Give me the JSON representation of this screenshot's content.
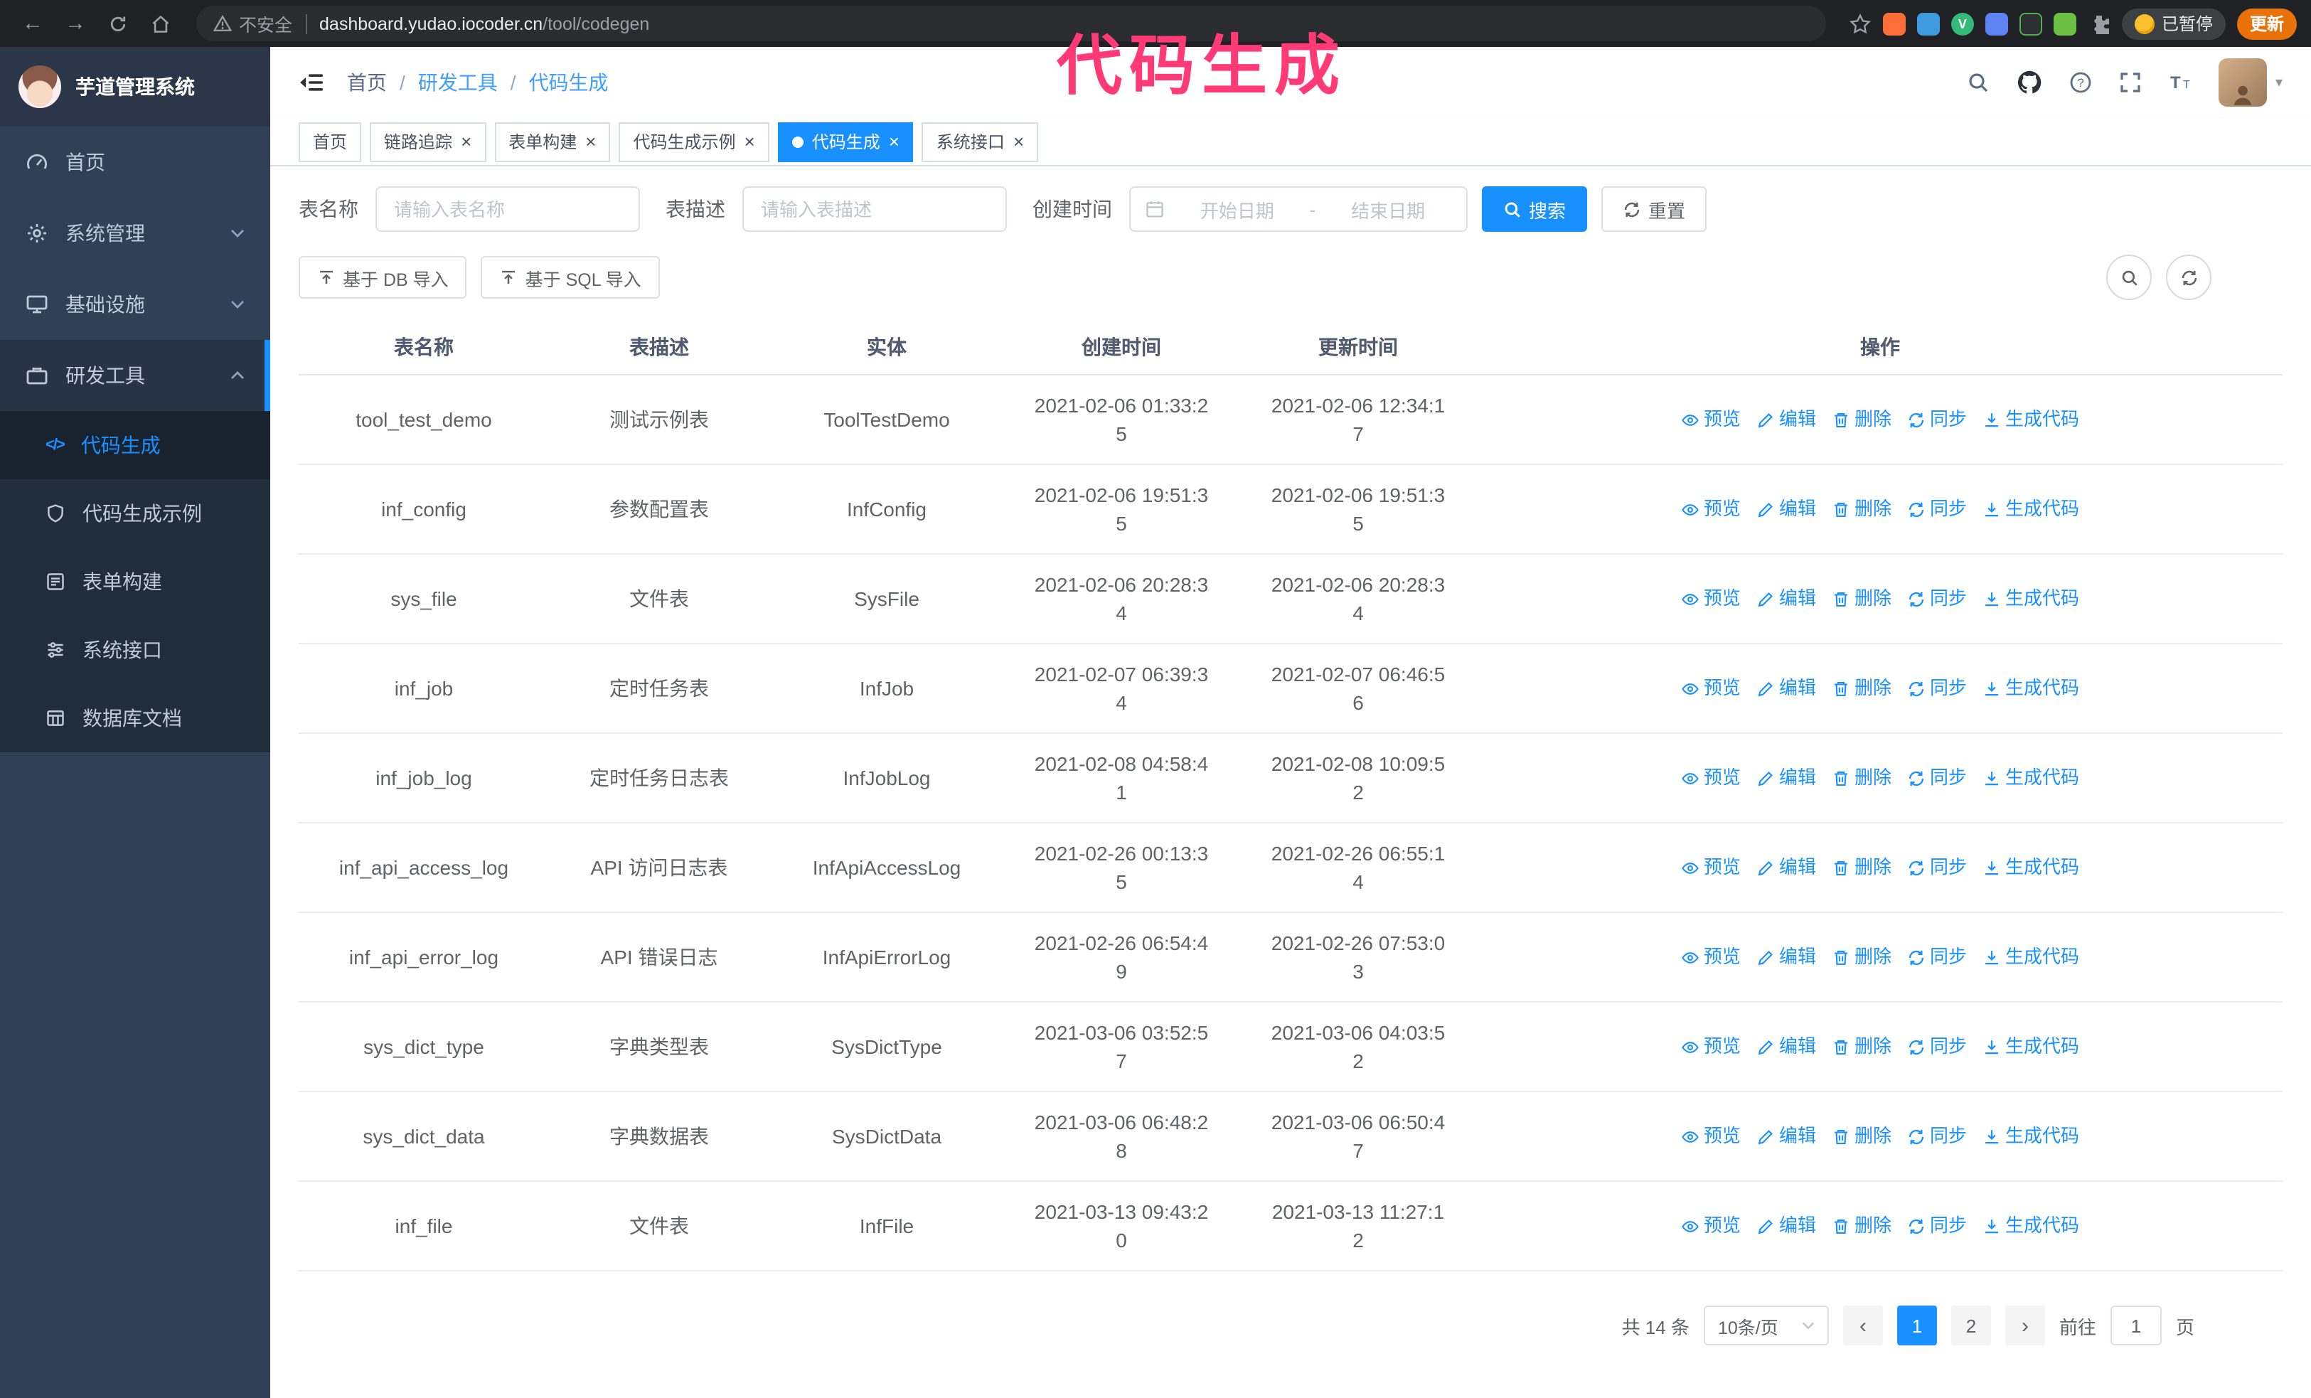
{
  "colors": {
    "primary": "#1890ff",
    "annotation": "#ff3a77",
    "sidebar_bg": "#304156",
    "submenu_bg": "#1f2d3d"
  },
  "browser": {
    "security_label": "不安全",
    "url_host": "dashboard.yudao.iocoder.cn",
    "url_path": "/tool/codegen",
    "paused_badge": "已暂停",
    "update_button": "更新"
  },
  "annotation": {
    "text": "代码生成"
  },
  "sidebar": {
    "logo_title": "芋道管理系统",
    "items": [
      "首页",
      "系统管理",
      "基础设施",
      "研发工具"
    ],
    "submenu": [
      "代码生成",
      "代码生成示例",
      "表单构建",
      "系统接口",
      "数据库文档"
    ]
  },
  "header": {
    "breadcrumb": [
      "首页",
      "研发工具",
      "代码生成"
    ]
  },
  "tabs": [
    {
      "label": "首页",
      "closable": false,
      "active": false
    },
    {
      "label": "链路追踪",
      "closable": true,
      "active": false
    },
    {
      "label": "表单构建",
      "closable": true,
      "active": false
    },
    {
      "label": "代码生成示例",
      "closable": true,
      "active": false
    },
    {
      "label": "代码生成",
      "closable": true,
      "active": true
    },
    {
      "label": "系统接口",
      "closable": true,
      "active": false
    }
  ],
  "filters": {
    "table_name_label": "表名称",
    "table_name_placeholder": "请输入表名称",
    "table_desc_label": "表描述",
    "table_desc_placeholder": "请输入表描述",
    "create_time_label": "创建时间",
    "date_start_placeholder": "开始日期",
    "date_separator": "-",
    "date_end_placeholder": "结束日期",
    "search_button": "搜索",
    "reset_button": "重置"
  },
  "toolbar": {
    "import_db_button": "基于 DB 导入",
    "import_sql_button": "基于 SQL 导入"
  },
  "table": {
    "columns": [
      "表名称",
      "表描述",
      "实体",
      "创建时间",
      "更新时间",
      "操作"
    ],
    "ops": [
      "预览",
      "编辑",
      "删除",
      "同步",
      "生成代码"
    ],
    "rows": [
      {
        "name": "tool_test_demo",
        "desc": "测试示例表",
        "entity": "ToolTestDemo",
        "created": "2021-02-06 01:33:25",
        "updated": "2021-02-06 12:34:17"
      },
      {
        "name": "inf_config",
        "desc": "参数配置表",
        "entity": "InfConfig",
        "created": "2021-02-06 19:51:35",
        "updated": "2021-02-06 19:51:35"
      },
      {
        "name": "sys_file",
        "desc": "文件表",
        "entity": "SysFile",
        "created": "2021-02-06 20:28:34",
        "updated": "2021-02-06 20:28:34"
      },
      {
        "name": "inf_job",
        "desc": "定时任务表",
        "entity": "InfJob",
        "created": "2021-02-07 06:39:34",
        "updated": "2021-02-07 06:46:56"
      },
      {
        "name": "inf_job_log",
        "desc": "定时任务日志表",
        "entity": "InfJobLog",
        "created": "2021-02-08 04:58:41",
        "updated": "2021-02-08 10:09:52"
      },
      {
        "name": "inf_api_access_log",
        "desc": "API 访问日志表",
        "entity": "InfApiAccessLog",
        "created": "2021-02-26 00:13:35",
        "updated": "2021-02-26 06:55:14"
      },
      {
        "name": "inf_api_error_log",
        "desc": "API 错误日志",
        "entity": "InfApiErrorLog",
        "created": "2021-02-26 06:54:49",
        "updated": "2021-02-26 07:53:03"
      },
      {
        "name": "sys_dict_type",
        "desc": "字典类型表",
        "entity": "SysDictType",
        "created": "2021-03-06 03:52:57",
        "updated": "2021-03-06 04:03:52"
      },
      {
        "name": "sys_dict_data",
        "desc": "字典数据表",
        "entity": "SysDictData",
        "created": "2021-03-06 06:48:28",
        "updated": "2021-03-06 06:50:47"
      },
      {
        "name": "inf_file",
        "desc": "文件表",
        "entity": "InfFile",
        "created": "2021-03-13 09:43:20",
        "updated": "2021-03-13 11:27:12"
      }
    ]
  },
  "pagination": {
    "total_text": "共 14 条",
    "page_size": "10条/页",
    "pages": [
      "1",
      "2"
    ],
    "active_page": "1",
    "goto_label": "前往",
    "goto_value": "1",
    "goto_suffix": "页"
  }
}
